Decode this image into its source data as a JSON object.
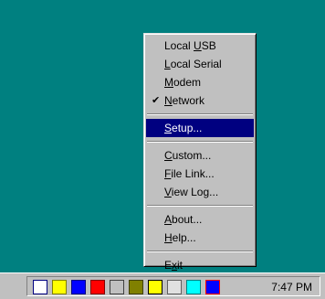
{
  "menu": {
    "items": [
      {
        "label": "Local USB",
        "mnemonic": "U",
        "checked": false
      },
      {
        "label": "Local Serial",
        "mnemonic": "L",
        "checked": false
      },
      {
        "label": "Modem",
        "mnemonic": "M",
        "checked": false
      },
      {
        "label": "Network",
        "mnemonic": "N",
        "checked": true
      },
      {
        "separator": true
      },
      {
        "label": "Setup...",
        "mnemonic": "S",
        "highlighted": true
      },
      {
        "separator": true
      },
      {
        "label": "Custom...",
        "mnemonic": "C"
      },
      {
        "label": "File Link...",
        "mnemonic": "F"
      },
      {
        "label": "View Log...",
        "mnemonic": "V"
      },
      {
        "separator": true
      },
      {
        "label": "About...",
        "mnemonic": "A"
      },
      {
        "label": "Help...",
        "mnemonic": "H"
      },
      {
        "separator": true
      },
      {
        "label": "Exit",
        "mnemonic": "x"
      }
    ],
    "check_glyph": "✔"
  },
  "taskbar": {
    "clock": "7:47 PM",
    "tray_icons": [
      "connection-icon",
      "notepad-icon",
      "network-icon",
      "virus-shield-icon",
      "monitor-icon",
      "audio-icon",
      "volume-icon",
      "disk-icon",
      "network-cable-icon",
      "power-icon"
    ]
  },
  "colors": {
    "desktop": "#008080",
    "menu_face": "#c0c0c0",
    "highlight": "#000080"
  }
}
